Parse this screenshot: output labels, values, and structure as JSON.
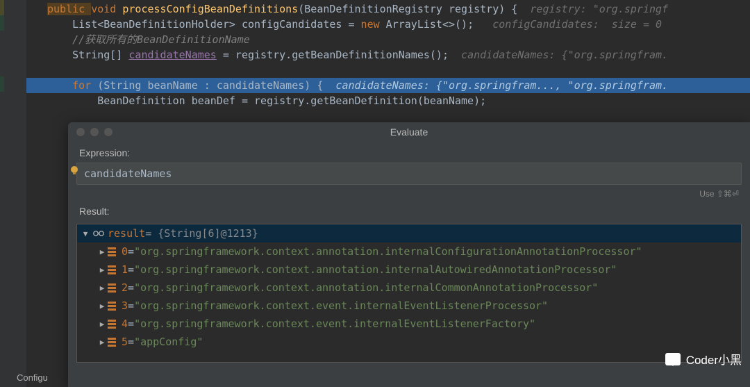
{
  "code": {
    "line1": {
      "pre": "public ",
      "kw2": "void ",
      "method": "processConfigBeanDefinitions",
      "rest": "(BeanDefinitionRegistry registry) {",
      "hint": "  registry: \"org.springf"
    },
    "line2": {
      "text": "    List<BeanDefinitionHolder> configCandidates = ",
      "new": "new ",
      "tail": "ArrayList<>();",
      "hint": "   configCandidates:  size = 0"
    },
    "line3": {
      "comment": "    //获取所有的BeanDefinitionName"
    },
    "line4": {
      "text": "    String[] ",
      "var": "candidateNames",
      "tail": " = registry.getBeanDefinitionNames();",
      "hint": "  candidateNames: {\"org.springfram."
    },
    "line5": {
      "for": "    for ",
      "rest": "(String beanName : candidateNames) {",
      "hint": "  candidateNames: {\"org.springfram..., \"org.springfram."
    },
    "line6": {
      "text": "        BeanDefinition beanDef = registry.getBeanDefinition(beanName);"
    }
  },
  "dialog": {
    "title": "Evaluate",
    "expression_label": "Expression:",
    "expression_value": "candidateNames",
    "shortcut_hint": "Use ⇧⌘⏎",
    "result_label": "Result:",
    "root": {
      "name": "result",
      "type": " = {String[6]@1213}"
    },
    "items": [
      {
        "idx": "0",
        "val": "\"org.springframework.context.annotation.internalConfigurationAnnotationProcessor\""
      },
      {
        "idx": "1",
        "val": "\"org.springframework.context.annotation.internalAutowiredAnnotationProcessor\""
      },
      {
        "idx": "2",
        "val": "\"org.springframework.context.annotation.internalCommonAnnotationProcessor\""
      },
      {
        "idx": "3",
        "val": "\"org.springframework.context.event.internalEventListenerProcessor\""
      },
      {
        "idx": "4",
        "val": "\"org.springframework.context.event.internalEventListenerFactory\""
      },
      {
        "idx": "5",
        "val": "\"appConfig\""
      }
    ]
  },
  "watermark": "Coder小黑",
  "bottom_tab": "Configu"
}
